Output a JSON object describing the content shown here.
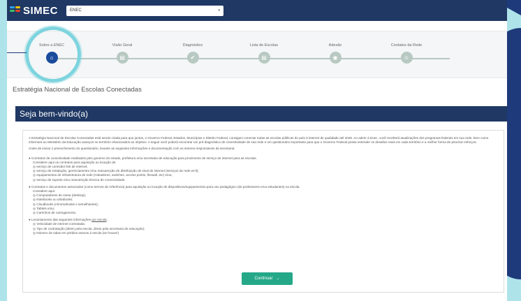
{
  "header": {
    "logo_text": "SIMEC",
    "module_value": "ENEC",
    "caret": "▾"
  },
  "stepper": {
    "steps": [
      {
        "label": "Sobre a ENEC",
        "icon": "⌂"
      },
      {
        "label": "Visão Geral",
        "icon": "▤"
      },
      {
        "label": "Diagnóstico",
        "icon": "✔"
      },
      {
        "label": "Lista de Escolas",
        "icon": "▤"
      },
      {
        "label": "Adesão",
        "icon": "◉"
      },
      {
        "label": "Contatos da Rede",
        "icon": "☺"
      }
    ]
  },
  "page": {
    "title": "Estratégia Nacional de Escolas Conectadas",
    "welcome": "Seja bem-vindo(a)"
  },
  "intro": {
    "p1": "A Estratégia Nacional de Escolas Conectadas está sendo criada para que juntos, o Governo Federal, Estados, Municípios e Distrito Federal, consigam conectar todas as escolas públicas do país à internet de qualidade até 2026. Ao aderir à Enec, você receberá atualizações dos programas federais em sua rede, bem como informará ao Ministério da Educação avanços no território relacionados ao objetivo. A seguir você poderá encontrar um pré-diagnóstico de conectividade de sua rede e um questionário importante para que o Governo Federal possa entender os desafios reais em cada território e a melhor forma de priorizar esforços.",
    "p2": "Antes de iniciar o preenchimento do questionário, levante as seguintes informações e documentação com os setores responsáveis da secretaria:"
  },
  "list1": {
    "head": "● Contratos de conectividade realizados pelo governo do estado, prefeitura e/ou secretaria de educação para provimento de serviço de internet para as escolas.",
    "lead": "Considere aqui os contratos para aquisição ou locação de:",
    "items": [
      "◎ serviço de conexão/ link de internet;",
      "◎ serviço de instalação, gerenciamento e/ou manutenção de distribuição de sinal de internet (serviços de rede wi-fi);",
      "◎ equipamentos de infraestrutura de rede (roteadores, switches, access points, firewall, etc) e/ou;",
      "◎ serviço de suporte e/ou manutenção técnica de conectividade."
    ]
  },
  "list2": {
    "head": "● Contratos e documentos associados (como termos de referência) para aquisição ou locação de dispositivos/equipamentos para uso pedagógico (de professores e/ou estudantes) na escola.",
    "lead": "Considere aqui:",
    "items": [
      "◎ Computadores de mesa (desktop);",
      "◎ Notebooks ou ultrabooks;",
      "◎ Cloudbooks (chromebooks e semelhantes);",
      "◎ Tablets e/ou;",
      "◎ Carrinhos de carregamento."
    ]
  },
  "list3": {
    "head_prefix": "● Levantamento das seguintes informações ",
    "head_link": "por escola",
    "head_suffix": ":",
    "items": [
      "◎ Velocidade de internet contratada;",
      "◎ Tipo de contratação (direto pela escola, direto pela secretaria de educação);",
      "◎ Número de salas em prédios anexos à escola (se houver)"
    ]
  },
  "actions": {
    "continue_label": "Continuar",
    "continue_arrow": "→"
  },
  "colors": {
    "header_bg": "#1f3864",
    "step_active": "#1a4b9c",
    "step_inactive": "#b8c9c2",
    "continue_btn": "#25a888"
  }
}
